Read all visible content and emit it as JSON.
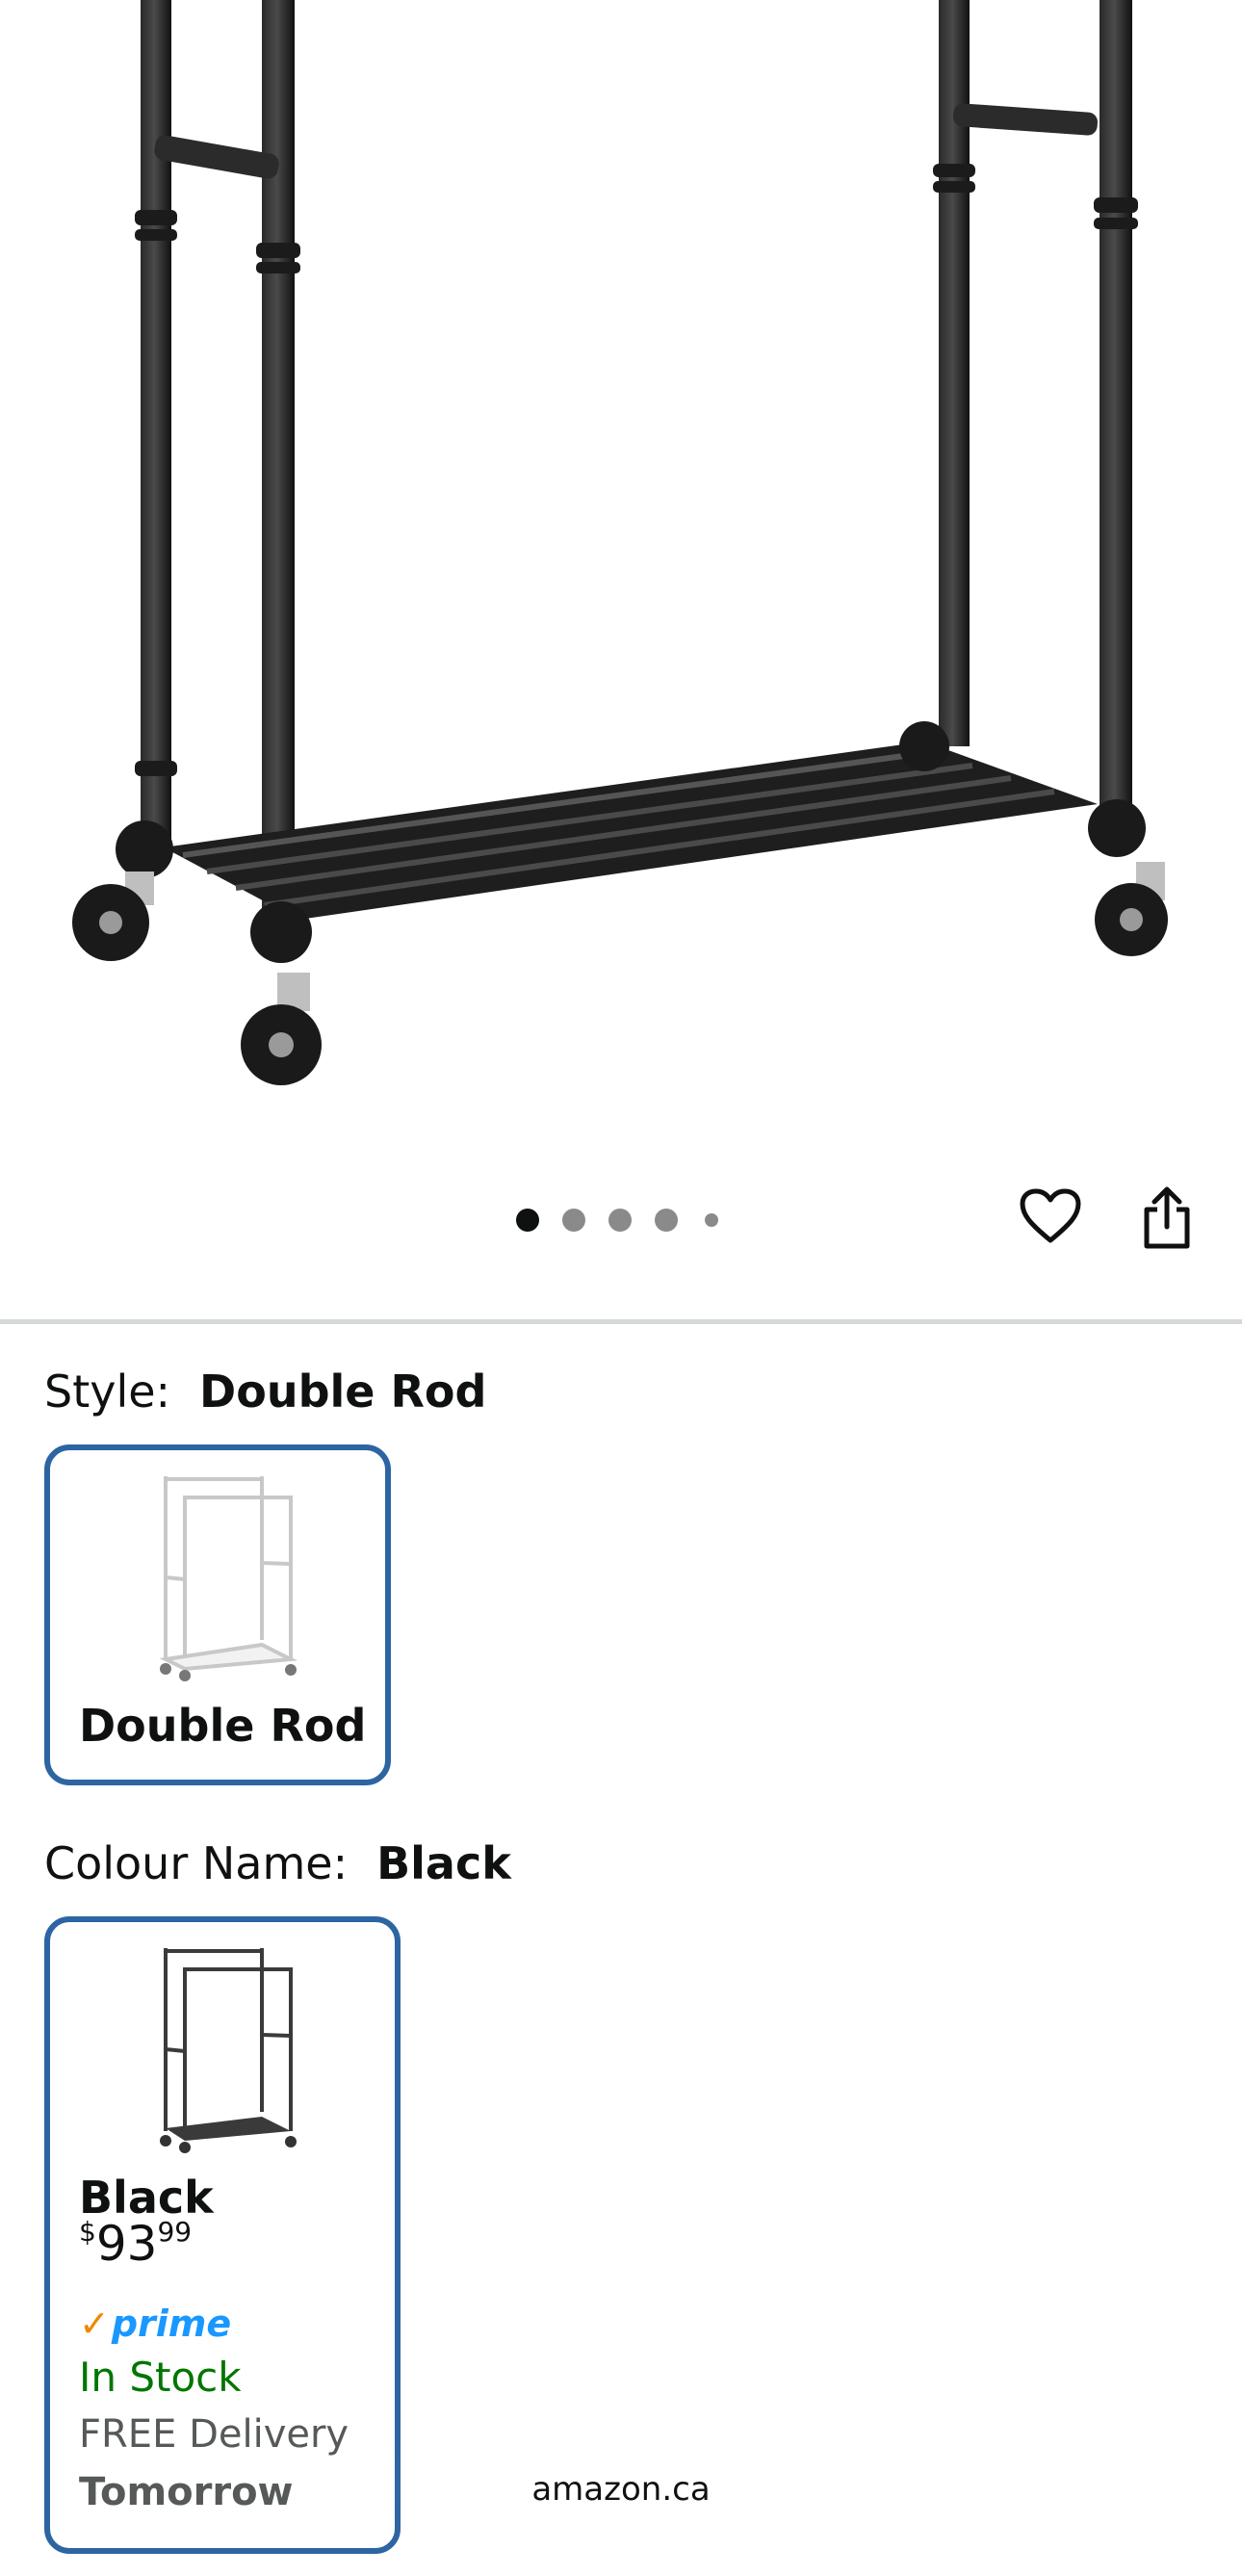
{
  "product_image": {
    "icon": "garment-rack-product-photo",
    "carousel": {
      "dot_count": 5,
      "active_index": 0
    }
  },
  "actions": {
    "wishlist_icon": "heart-outline-icon",
    "share_icon": "share-icon"
  },
  "style": {
    "label": "Style:",
    "selected": "Double Rod",
    "options": [
      {
        "name": "Double Rod",
        "icon": "white-double-rod-rack-thumbnail"
      }
    ]
  },
  "colour": {
    "label": "Colour Name:",
    "selected": "Black",
    "options": [
      {
        "name": "Black",
        "icon": "black-double-rod-rack-thumbnail",
        "price_symbol": "$",
        "price_whole": "93",
        "price_fraction": "99",
        "prime_check": "✓",
        "prime_label": "prime",
        "stock": "In Stock",
        "delivery": "FREE Delivery",
        "delivery_date": "Tomorrow"
      }
    ]
  },
  "browser": {
    "url": "amazon.ca"
  },
  "colors": {
    "selected_border": "#2d64a2",
    "in_stock": "#007600",
    "prime_blue": "#1a98ff",
    "prime_check": "#f08804"
  }
}
